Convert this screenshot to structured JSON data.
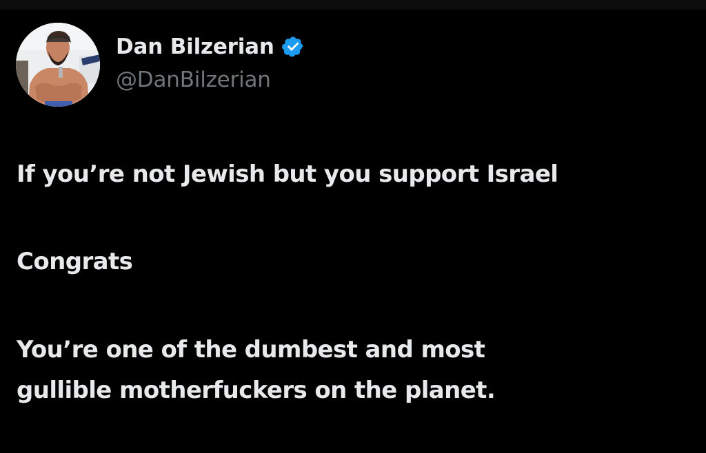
{
  "author": {
    "display_name": "Dan Bilzerian",
    "handle": "@DanBilzerian",
    "verified": true,
    "avatar_icon": "profile-photo-shirtless-man",
    "badge_icon": "verified-checkmark-icon",
    "badge_color": "#1d9bf0"
  },
  "tweet": {
    "lines": [
      "If you’re not Jewish but you support Israel",
      "Congrats",
      "You’re one of the dumbest and most",
      "gullible motherfuckers on the planet."
    ]
  },
  "colors": {
    "background": "#000000",
    "text_primary": "#e7e9ea",
    "text_secondary": "#71767b"
  }
}
